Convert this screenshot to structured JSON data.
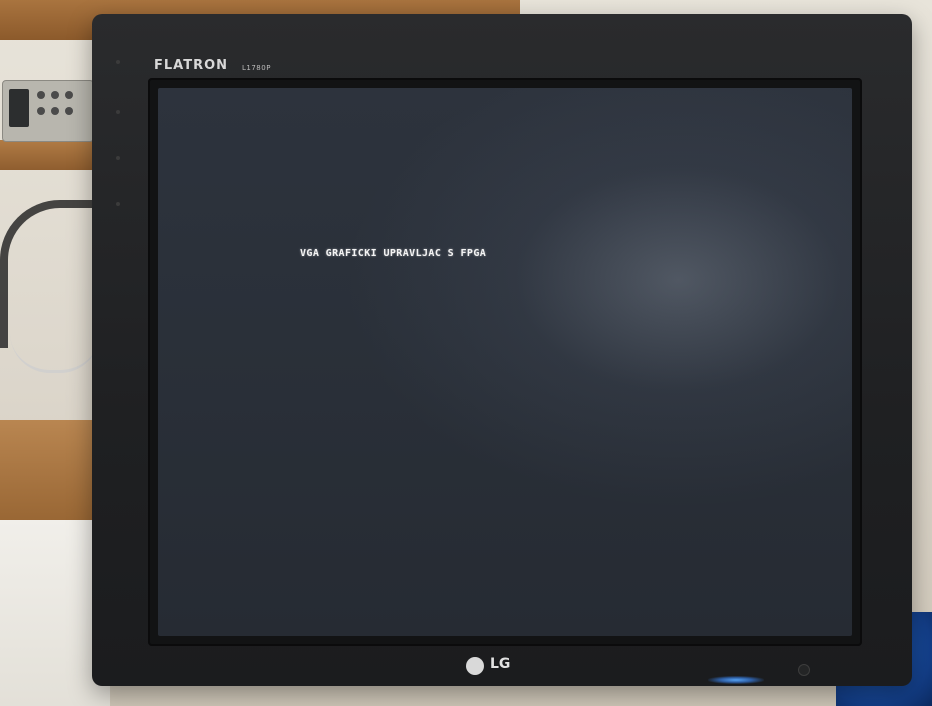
{
  "monitor": {
    "brand_label": "FLATRON",
    "model_label": "L1780P",
    "logo_text": "LG"
  },
  "screen": {
    "text": "VGA GRAFICKI UPRAVLJAC S FPGA"
  },
  "colors": {
    "screen_bg": "#2a3039",
    "bezel": "#1f2022",
    "power_led": "#5aa9ff"
  }
}
